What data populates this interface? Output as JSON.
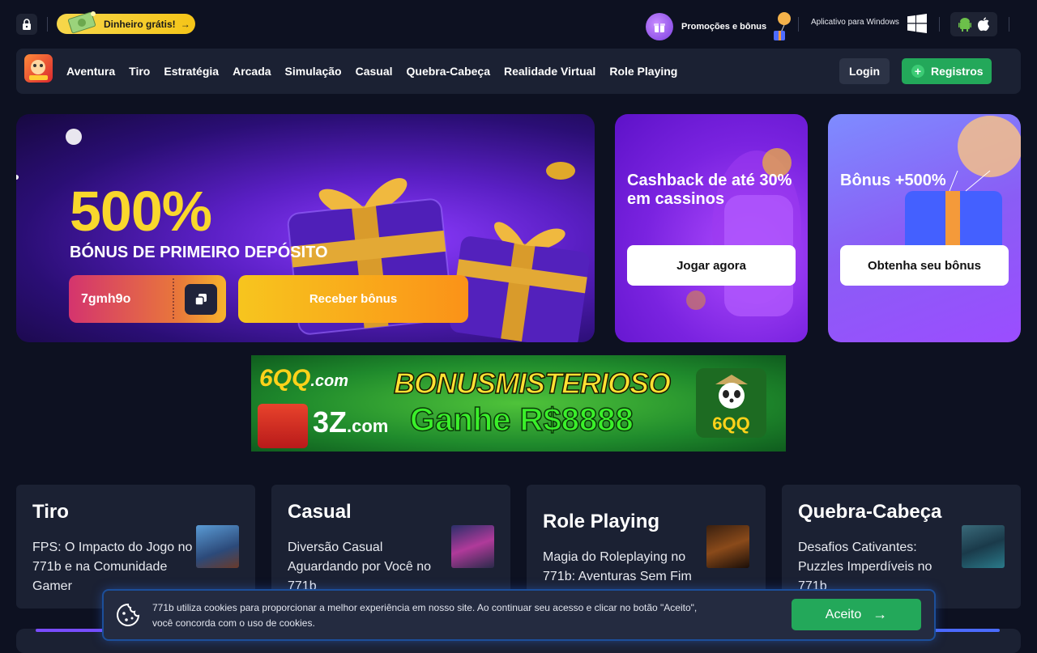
{
  "topbar": {
    "free_money_label": "Dinheiro grátis!",
    "free_money_arrow": "→",
    "promo_label": "Promoções e bônus",
    "windows_app_label": "Aplicativo para Windows"
  },
  "nav": {
    "items": [
      "Aventura",
      "Tiro",
      "Estratégia",
      "Arcada",
      "Simulação",
      "Casual",
      "Quebra-Cabeça",
      "Realidade Virtual",
      "Role Playing"
    ],
    "login_label": "Login",
    "register_label": "Registros",
    "register_plus": "+"
  },
  "hero": {
    "percent": "500%",
    "subtitle": "BÓNUS DE PRIMEIRO DEPÓSITO",
    "code": "7gmh9o",
    "button_label": "Receber bônus"
  },
  "promo_cards": [
    {
      "title": "Cashback de até 30% em cassinos",
      "button_label": "Jogar agora"
    },
    {
      "title": "Bônus +500%",
      "button_label": "Obtenha seu bônus"
    }
  ],
  "banner": {
    "brand_6qq": "6QQ",
    "brand_6qq_tld": ".com",
    "headline": "BONUSMISTERIOSO",
    "prize": "Ganhe R$8888",
    "brand_3z": "3Z",
    "brand_3z_tld": ".com",
    "panda_brand": "6QQ"
  },
  "game_cards": [
    {
      "title": "Tiro",
      "desc": "FPS: O Impacto do Jogo no 771b e na Comunidade Gamer"
    },
    {
      "title": "Casual",
      "desc": "Diversão Casual Aguardando por Você no 771b"
    },
    {
      "title": "Role Playing",
      "desc": "Magia do Roleplaying no 771b: Aventuras Sem Fim"
    },
    {
      "title": "Quebra-Cabeça",
      "desc": "Desafios Cativantes: Puzzles Imperdíveis no 771b"
    }
  ],
  "cookie": {
    "text": "771b utiliza cookies para proporcionar a melhor experiência em nosso site. Ao continuar seu acesso e clicar no botão \"Aceito\", você concorda com o uso de cookies.",
    "accept_label": "Aceito",
    "accept_arrow": "→"
  },
  "colors": {
    "background": "#0d1121",
    "panel": "#1b2133",
    "accent_green": "#23a85a",
    "accent_yellow": "#f9d72c"
  }
}
